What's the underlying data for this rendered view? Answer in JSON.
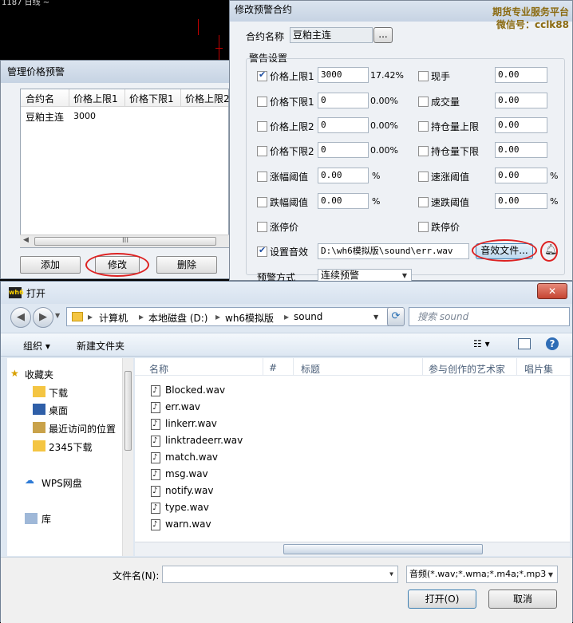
{
  "background": {
    "top_text": "1187   日线 ~"
  },
  "manage_dialog": {
    "title": "管理价格预警",
    "columns": [
      "合约名",
      "价格上限1",
      "价格下限1",
      "价格上限2"
    ],
    "rows": [
      [
        "豆粕主连",
        "3000",
        "",
        ""
      ]
    ],
    "scroll_glyph": "III",
    "buttons": {
      "add": "添加",
      "modify": "修改",
      "delete": "删除"
    }
  },
  "modify_dialog": {
    "title": "修改预警合约",
    "brand_line1": "期货专业服务平台",
    "brand_line2": "微信号：cclk88",
    "contract_label": "合约名称",
    "contract_value": "豆粕主连",
    "browse_label": "...",
    "group_label": "警告设置",
    "left_items": [
      {
        "label": "价格上限1",
        "checked": true,
        "value": "3000",
        "pct": "17.42%"
      },
      {
        "label": "价格下限1",
        "checked": false,
        "value": "0",
        "pct": "0.00%"
      },
      {
        "label": "价格上限2",
        "checked": false,
        "value": "0",
        "pct": "0.00%"
      },
      {
        "label": "价格下限2",
        "checked": false,
        "value": "0",
        "pct": "0.00%"
      },
      {
        "label": "涨幅阈值",
        "checked": false,
        "value": "0.00",
        "pct": "%"
      },
      {
        "label": "跌幅阈值",
        "checked": false,
        "value": "0.00",
        "pct": "%"
      },
      {
        "label": "涨停价",
        "checked": false
      }
    ],
    "right_items": [
      {
        "label": "现手",
        "checked": false,
        "value": "0.00",
        "pct": ""
      },
      {
        "label": "成交量",
        "checked": false,
        "value": "0.00",
        "pct": ""
      },
      {
        "label": "持仓量上限",
        "checked": false,
        "value": "0.00",
        "pct": ""
      },
      {
        "label": "持仓量下限",
        "checked": false,
        "value": "0.00",
        "pct": ""
      },
      {
        "label": "速涨阈值",
        "checked": false,
        "value": "0.00",
        "pct": "%"
      },
      {
        "label": "速跌阈值",
        "checked": false,
        "value": "0.00",
        "pct": "%"
      },
      {
        "label": "跌停价",
        "checked": false
      }
    ],
    "sound_label": "设置音效",
    "sound_checked": true,
    "sound_path": "D:\\wh6模拟版\\sound\\err.wav",
    "sound_button": "音效文件...",
    "mode_label": "预警方式",
    "mode_value": "连续预警"
  },
  "open_dialog": {
    "title": "打开",
    "app_icon": "wh6",
    "close_glyph": "✕",
    "breadcrumb": [
      "计算机",
      "本地磁盘 (D:)",
      "wh6模拟版",
      "sound"
    ],
    "search_placeholder": "搜索 sound",
    "organize": "组织 ▾",
    "new_folder": "新建文件夹",
    "nav_items": [
      "收藏夹",
      "下载",
      "桌面",
      "最近访问的位置",
      "2345下载",
      "WPS网盘",
      "库"
    ],
    "columns": [
      "名称",
      "#",
      "标题",
      "参与创作的艺术家",
      "唱片集"
    ],
    "files": [
      "Blocked.wav",
      "err.wav",
      "linkerr.wav",
      "linktradeerr.wav",
      "match.wav",
      "msg.wav",
      "notify.wav",
      "type.wav",
      "warn.wav"
    ],
    "filename_label": "文件名(N):",
    "filename_value": "",
    "filetype_value": "音频(*.wav;*.wma;*.m4a;*.mp3",
    "open_button": "打开(O)",
    "cancel_button": "取消"
  },
  "colors": {
    "annotation_red": "#d22222",
    "brand_gold": "#8b6b12"
  }
}
